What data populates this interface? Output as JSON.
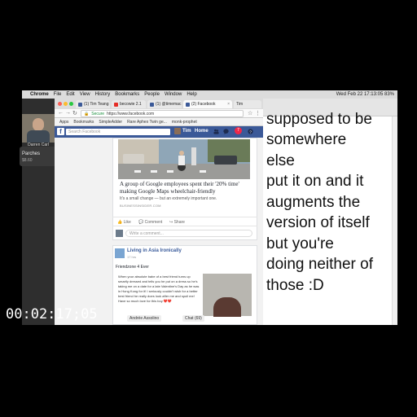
{
  "menubar": {
    "apple": "",
    "app_name": "Chrome",
    "items": [
      "File",
      "Edit",
      "View",
      "History",
      "Bookmarks",
      "People",
      "Window",
      "Help"
    ],
    "status_right": "Wed Feb 22 17:13:05  83%"
  },
  "call": {
    "webcam_caption": "Darren Carl",
    "name": "Parches",
    "time": "$8.60"
  },
  "browser": {
    "tabs": [
      {
        "label": "(1) Tim Teang",
        "color": "#3b5998"
      },
      {
        "label": "becowie 2.1",
        "color": "#e52d27"
      },
      {
        "label": "(1) @timemac",
        "color": "#3b5998"
      },
      {
        "label": "(2) Facebook",
        "color": "#3b5998"
      },
      {
        "label": "Tim",
        "color": "#888888"
      }
    ],
    "secure_label": "Secure",
    "url": "https://www.facebook.com",
    "bookmarks": [
      "Apps",
      "Bookmarks",
      "SimpleAdder",
      "Rare Aphex Twin ge...",
      "monk-prophet"
    ]
  },
  "facebook": {
    "logo": "f",
    "search_placeholder": "Search Facebook",
    "user": "Tim",
    "home": "Home",
    "notifications": "7",
    "post1": {
      "link_title": "A group of Google employees spent their '20% time' making Google Maps wheelchair-friendly",
      "link_desc": "It's a small change — but an extremely important one.",
      "link_domain": "BUSINESSINSIDER.COM",
      "like": "Like",
      "comment": "Comment",
      "share": "Share",
      "comment_placeholder": "Write a comment..."
    },
    "post2": {
      "page_name": "Living in Asia Ironically",
      "time": "17 hrs",
      "caption": "Friendzone 4 Ever",
      "text": "When your absolute babe of a best friend turns up smartly dressed and tells you he put on a dress so he's taking me on a date for a late Valentine's Day as he was in Hong Kong for it! I seriously couldn't wish for a better best friend he really does look after me and spoil me! Have so much love for this boy ❤️❤️",
      "tags": [
        "Andrée Assolino",
        "Chat (69)"
      ]
    }
  },
  "right_pane": {
    "lines": [
      "supposed to be",
      "somewhere",
      "else",
      "put it on and it",
      "augments the",
      "version of itself",
      "but you're",
      "doing neither of",
      "those :D"
    ]
  },
  "timestamp": "00:02:17;05"
}
